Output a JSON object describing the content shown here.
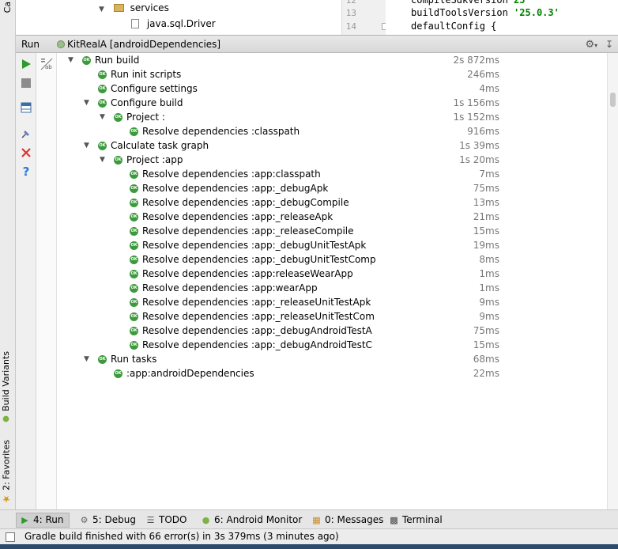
{
  "project_tree": {
    "rows": [
      {
        "label": "services",
        "kind": "folder"
      },
      {
        "label": "java.sql.Driver",
        "kind": "file"
      }
    ]
  },
  "left_stripe_top": {
    "label": "Ca"
  },
  "editor": {
    "line_numbers": [
      "12",
      "13",
      "14"
    ],
    "lines": [
      {
        "plain": "compileSdkVersion ",
        "str": "25"
      },
      {
        "plain": "buildToolsVersion ",
        "str": "'25.0.3'"
      },
      {
        "plain": "defaultConfig {",
        "str": ""
      }
    ]
  },
  "run_window": {
    "label": "Run",
    "configuration": "KitRealA [androidDependencies]",
    "header_icons": [
      "gear-icon",
      "hide-icon"
    ]
  },
  "toolbar": {
    "buttons": [
      "rerun-icon",
      "stop-icon",
      "layout-icon",
      "pin-icon",
      "close-icon",
      "help-icon"
    ]
  },
  "build_tree": [
    {
      "level": 0,
      "expanded": true,
      "label": "Run build",
      "time": "2s 872ms"
    },
    {
      "level": 1,
      "expanded": null,
      "label": "Run init scripts",
      "time": "246ms"
    },
    {
      "level": 1,
      "expanded": null,
      "label": "Configure settings",
      "time": "4ms"
    },
    {
      "level": 1,
      "expanded": true,
      "label": "Configure build",
      "time": "1s 156ms"
    },
    {
      "level": 2,
      "expanded": true,
      "label": "Project :",
      "time": "1s 152ms"
    },
    {
      "level": 3,
      "expanded": null,
      "label": "Resolve dependencies :classpath",
      "time": "916ms"
    },
    {
      "level": 1,
      "expanded": true,
      "label": "Calculate task graph",
      "time": "1s 39ms"
    },
    {
      "level": 2,
      "expanded": true,
      "label": "Project :app",
      "time": "1s 20ms"
    },
    {
      "level": 3,
      "expanded": null,
      "label": "Resolve dependencies :app:classpath",
      "time": "7ms"
    },
    {
      "level": 3,
      "expanded": null,
      "label": "Resolve dependencies :app:_debugApk",
      "time": "75ms"
    },
    {
      "level": 3,
      "expanded": null,
      "label": "Resolve dependencies :app:_debugCompile",
      "time": "13ms"
    },
    {
      "level": 3,
      "expanded": null,
      "label": "Resolve dependencies :app:_releaseApk",
      "time": "21ms"
    },
    {
      "level": 3,
      "expanded": null,
      "label": "Resolve dependencies :app:_releaseCompile",
      "time": "15ms"
    },
    {
      "level": 3,
      "expanded": null,
      "label": "Resolve dependencies :app:_debugUnitTestApk",
      "time": "19ms"
    },
    {
      "level": 3,
      "expanded": null,
      "label": "Resolve dependencies :app:_debugUnitTestComp",
      "time": "8ms"
    },
    {
      "level": 3,
      "expanded": null,
      "label": "Resolve dependencies :app:releaseWearApp",
      "time": "1ms"
    },
    {
      "level": 3,
      "expanded": null,
      "label": "Resolve dependencies :app:wearApp",
      "time": "1ms"
    },
    {
      "level": 3,
      "expanded": null,
      "label": "Resolve dependencies :app:_releaseUnitTestApk",
      "time": "9ms"
    },
    {
      "level": 3,
      "expanded": null,
      "label": "Resolve dependencies :app:_releaseUnitTestCom",
      "time": "9ms"
    },
    {
      "level": 3,
      "expanded": null,
      "label": "Resolve dependencies :app:_debugAndroidTestA",
      "time": "75ms"
    },
    {
      "level": 3,
      "expanded": null,
      "label": "Resolve dependencies :app:_debugAndroidTestC",
      "time": "15ms"
    },
    {
      "level": 1,
      "expanded": true,
      "label": "Run tasks",
      "time": "68ms"
    },
    {
      "level": 2,
      "expanded": null,
      "label": ":app:androidDependencies",
      "time": "22ms"
    }
  ],
  "ok_badge": "OK",
  "side_tabs": {
    "build_variants": "Build Variants",
    "favorites": "2: Favorites"
  },
  "bottom_tabs": [
    {
      "label": "4: Run",
      "icon": "run-icon",
      "active": true
    },
    {
      "label": "5: Debug",
      "icon": "bug-icon",
      "active": false
    },
    {
      "label": "TODO",
      "icon": "todo-icon",
      "active": false
    },
    {
      "label": "6: Android Monitor",
      "icon": "android-icon",
      "active": false
    },
    {
      "label": "0: Messages",
      "icon": "messages-icon",
      "active": false
    },
    {
      "label": "Terminal",
      "icon": "terminal-icon",
      "active": false
    }
  ],
  "status_bar": {
    "message": "Gradle build finished with 66 error(s) in 3s 379ms (3 minutes ago)"
  },
  "colors": {
    "ok_green": "#3c9a3c",
    "run_green": "#2d9a2d",
    "stop_gray": "#8c8c8c",
    "close_red": "#d33",
    "help_blue": "#2a7ad8"
  }
}
